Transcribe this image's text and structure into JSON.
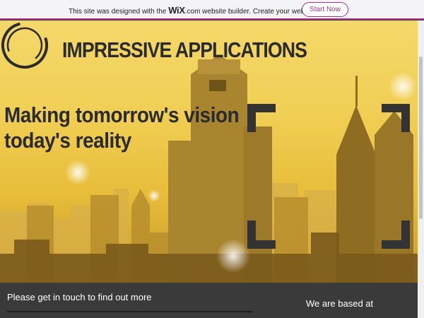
{
  "wix_banner": {
    "text_before": "This site was designed with the ",
    "logo": "WiX",
    "domain": ".com",
    "text_after": " website builder. Create your website today.",
    "button_label": "Start Now"
  },
  "hero": {
    "brand": "IMPRESSIVE APPLICATIONS",
    "tagline_line1": "Making tomorrow's vision",
    "tagline_line2": "today's reality"
  },
  "footer": {
    "contact": "Please get in touch to find out more",
    "based": "We are based at"
  },
  "colors": {
    "accent": "#a0338f",
    "dark": "#333333",
    "hero_yellow": "#f1cf55"
  }
}
